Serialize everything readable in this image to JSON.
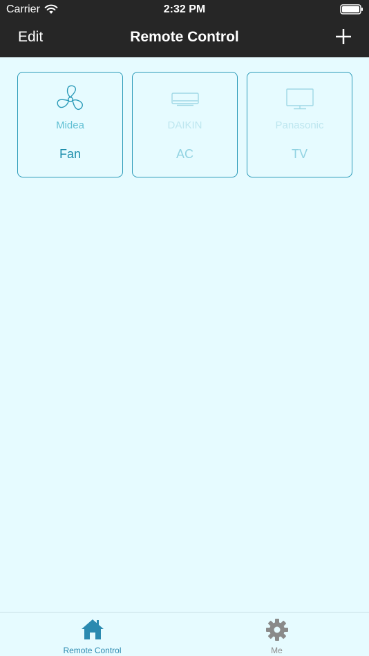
{
  "status_bar": {
    "carrier": "Carrier",
    "time": "2:32 PM"
  },
  "nav": {
    "edit_label": "Edit",
    "title": "Remote Control",
    "add_icon": "plus-icon"
  },
  "devices": [
    {
      "brand": "Midea",
      "type": "Fan",
      "icon": "fan-icon",
      "state": "active"
    },
    {
      "brand": "DAIKIN",
      "type": "AC",
      "icon": "air-conditioner-icon",
      "state": "inactive"
    },
    {
      "brand": "Panasonic",
      "type": "TV",
      "icon": "tv-icon",
      "state": "inactive"
    }
  ],
  "tab_bar": {
    "tabs": [
      {
        "label": "Remote Control",
        "icon": "home-icon",
        "selected": true
      },
      {
        "label": "Me",
        "icon": "gear-icon",
        "selected": false
      }
    ]
  },
  "colors": {
    "nav_background": "#262626",
    "page_background": "#e6fbff",
    "accent": "#2a9ab8",
    "tab_active": "#2b8ab0",
    "tab_inactive": "#8a8a8a"
  }
}
